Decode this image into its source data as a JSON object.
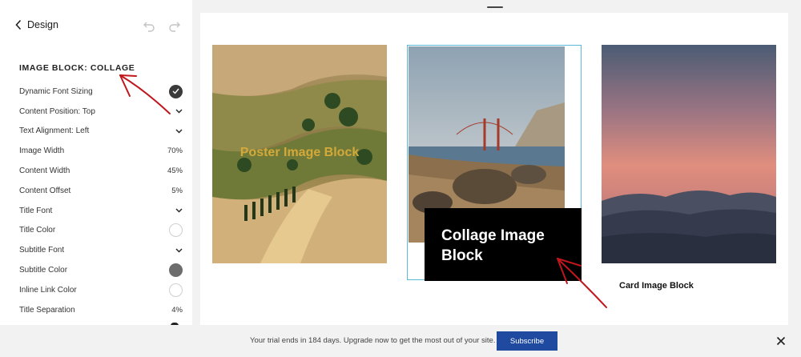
{
  "sidebar": {
    "back_label": "Design",
    "section_title": "IMAGE BLOCK: COLLAGE",
    "settings": [
      {
        "label": "Dynamic Font Sizing",
        "control": "check"
      },
      {
        "label": "Content Position: Top",
        "control": "chevron"
      },
      {
        "label": "Text Alignment: Left",
        "control": "chevron"
      },
      {
        "label": "Image Width",
        "value": "70%"
      },
      {
        "label": "Content Width",
        "value": "45%"
      },
      {
        "label": "Content Offset",
        "value": "5%"
      },
      {
        "label": "Title Font",
        "control": "chevron"
      },
      {
        "label": "Title Color",
        "control": "swatch",
        "color": "#ffffff"
      },
      {
        "label": "Subtitle Font",
        "control": "chevron"
      },
      {
        "label": "Subtitle Color",
        "control": "swatch",
        "color": "#6d6d6d"
      },
      {
        "label": "Inline Link Color",
        "control": "swatch",
        "color": "#ffffff"
      },
      {
        "label": "Title Separation",
        "value": "4%"
      }
    ]
  },
  "canvas": {
    "poster_title": "Poster Image Block",
    "collage_title": "Collage Image Block",
    "card_title": "Card Image Block"
  },
  "trial_bar": {
    "text": "Your trial ends in 184 days. Upgrade now to get the most out of your site.",
    "subscribe_label": "Subscribe"
  },
  "colors": {
    "accent_blue": "#1f4aa0",
    "selection_outline": "#5ab8d8",
    "annotation_red": "#c0161c",
    "poster_title": "#d4a93a"
  }
}
